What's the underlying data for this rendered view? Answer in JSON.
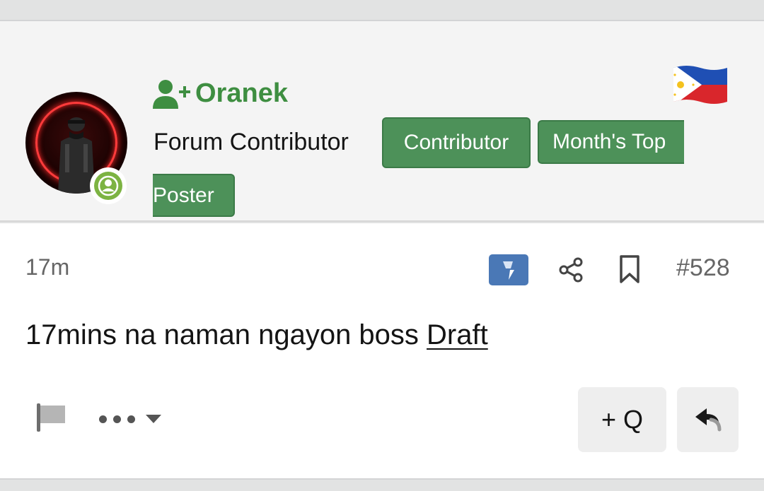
{
  "user": {
    "username": "Oranek",
    "role": "Forum Contributor",
    "badges": [
      "Contributor",
      "Month's Top",
      "Poster"
    ]
  },
  "post": {
    "time": "17m",
    "number": "#528",
    "message": "17mins na naman ngayon boss",
    "link_text": "Draft"
  },
  "actions": {
    "quote_label": "+ Q"
  },
  "icons": {
    "user_plus": "user-plus-icon",
    "flag": "philippines-flag-icon",
    "react": "react-icon",
    "share": "share-icon",
    "bookmark": "bookmark-icon",
    "report": "flag-icon",
    "more": "more-icon",
    "reply": "reply-icon"
  },
  "colors": {
    "username_green": "#3e8e41",
    "badge_green": "#4d9159",
    "online_green": "#7cb342",
    "react_blue": "#4a78b6"
  }
}
